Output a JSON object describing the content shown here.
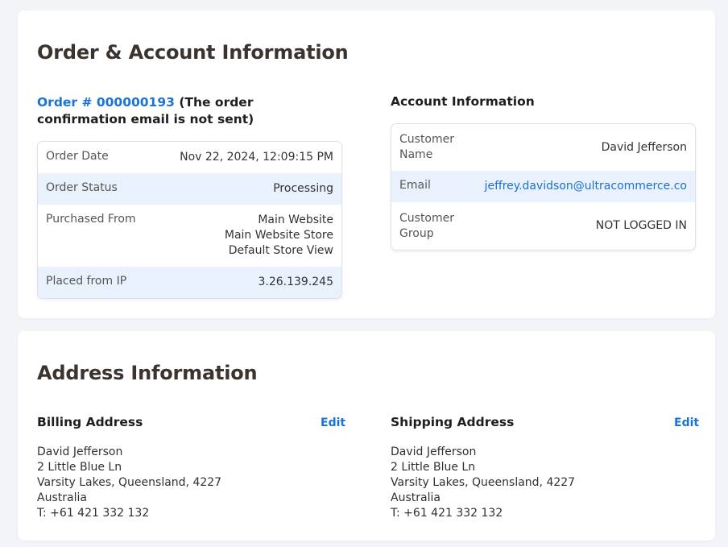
{
  "order_card": {
    "title": "Order & Account Information",
    "order_link": "Order # 000000193",
    "order_note": " (The order confirmation email is not sent)",
    "order_rows": [
      {
        "label": "Order Date",
        "value": "Nov 22, 2024, 12:09:15 PM"
      },
      {
        "label": "Order Status",
        "value": "Processing"
      },
      {
        "label": "Purchased From",
        "value_lines": [
          "Main Website",
          "Main Website Store",
          "Default Store View"
        ]
      },
      {
        "label": "Placed from IP",
        "value": "3.26.139.245"
      }
    ],
    "account_title": "Account Information",
    "account_rows": [
      {
        "label_lines": [
          "Customer",
          "Name"
        ],
        "value": "David Jefferson"
      },
      {
        "label": "Email",
        "value": "jeffrey.davidson@ultracommerce.co"
      },
      {
        "label_lines": [
          "Customer",
          "Group"
        ],
        "value": "NOT LOGGED IN"
      }
    ]
  },
  "address_card": {
    "title": "Address Information",
    "billing": {
      "title": "Billing Address",
      "edit_label": "Edit",
      "name": "David Jefferson",
      "street": "2 Little Blue Ln",
      "city_line": "Varsity Lakes, Queensland, 4227",
      "country": "Australia",
      "phone": "T: +61 421 332 132"
    },
    "shipping": {
      "title": "Shipping Address",
      "edit_label": "Edit",
      "name": "David Jefferson",
      "street": "2 Little Blue Ln",
      "city_line": "Varsity Lakes, Queensland, 4227",
      "country": "Australia",
      "phone": "T: +61 421 332 132"
    }
  },
  "colors": {
    "page_bg": "#f2f4f8",
    "link": "#1a73d8",
    "row_alt": "#e9f2fc"
  }
}
